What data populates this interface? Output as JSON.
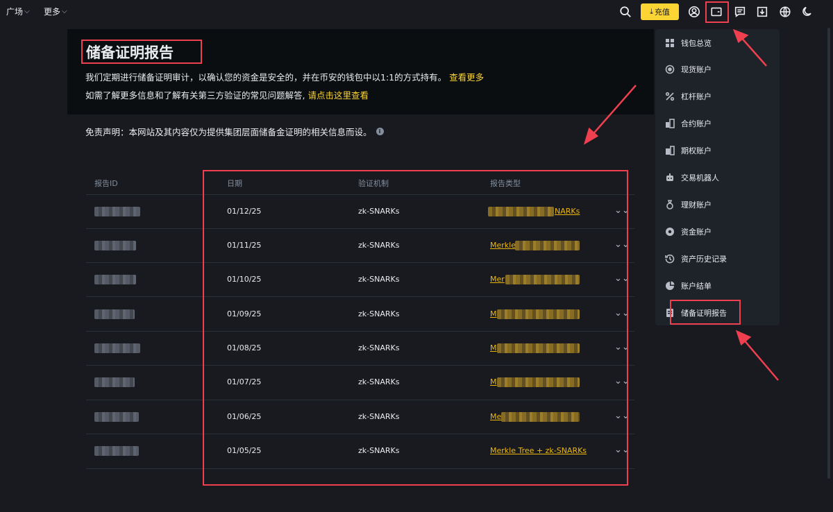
{
  "nav": {
    "square": "广场",
    "more": "更多"
  },
  "topbar": {
    "deposit_label": "充值",
    "icons": [
      "search-icon",
      "download-icon",
      "user-icon",
      "wallet-icon",
      "message-icon",
      "download-app-icon",
      "globe-icon",
      "moon-icon"
    ]
  },
  "hero": {
    "title": "储备证明报告",
    "line1": "我们定期进行储备证明审计，以确认您的资金是安全的，并在币安的钱包中以1:1的方式持有。",
    "line1_link": "查看更多",
    "line2": "如需了解更多信息和了解有关第三方验证的常见问题解答,",
    "line2_link": "请点击这里查看"
  },
  "disclaimer": "免责声明：本网站及其内容仅为提供集团层面储备金证明的相关信息而设。",
  "table": {
    "headers": [
      "报告ID",
      "日期",
      "验证机制",
      "报告类型"
    ],
    "rows": [
      {
        "date": "01/12/25",
        "mechanism": "zk-SNARKs",
        "type": "NARKs"
      },
      {
        "date": "01/11/25",
        "mechanism": "zk-SNARKs",
        "type": "Merkle"
      },
      {
        "date": "01/10/25",
        "mechanism": "zk-SNARKs",
        "type": "Mer"
      },
      {
        "date": "01/09/25",
        "mechanism": "zk-SNARKs",
        "type": "M"
      },
      {
        "date": "01/08/25",
        "mechanism": "zk-SNARKs",
        "type": "M"
      },
      {
        "date": "01/07/25",
        "mechanism": "zk-SNARKs",
        "type": "M"
      },
      {
        "date": "01/06/25",
        "mechanism": "zk-SNARKs",
        "type": "Me"
      },
      {
        "date": "01/05/25",
        "mechanism": "zk-SNARKs",
        "type": "Merkle Tree + zk-SNARKs"
      }
    ]
  },
  "menu": {
    "items": [
      "钱包总览",
      "现货账户",
      "杠杆账户",
      "合约账户",
      "期权账户",
      "交易机器人",
      "理财账户",
      "资金账户",
      "资产历史记录",
      "账户结单",
      "储备证明报告"
    ]
  },
  "colors": {
    "accent": "#fcd535",
    "link": "#f0b90b",
    "highlight": "#f0404f",
    "bg": "#181a20",
    "panel": "#1e2329"
  }
}
